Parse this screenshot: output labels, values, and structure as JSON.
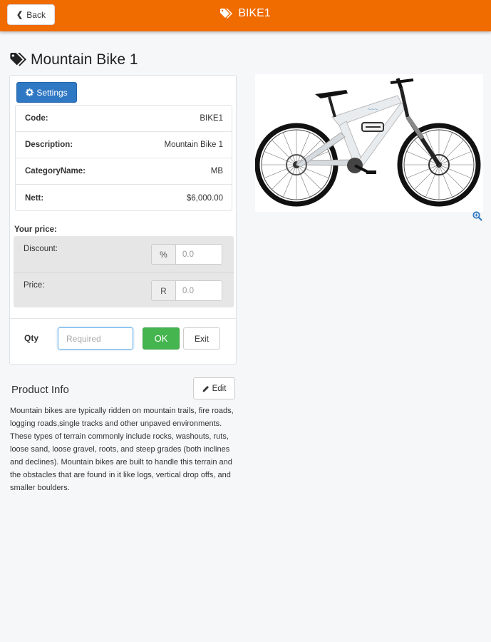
{
  "header": {
    "back_label": "Back",
    "title": "BIKE1",
    "bar_color": "#f06b00"
  },
  "product": {
    "title": "Mountain Bike 1",
    "settings_label": "Settings",
    "details": [
      {
        "label": "Code:",
        "value": "BIKE1"
      },
      {
        "label": "Description:",
        "value": "Mountain Bike 1"
      },
      {
        "label": "CategoryName:",
        "value": "MB"
      },
      {
        "label": "Nett:",
        "value": "$6,000.00"
      }
    ]
  },
  "pricing": {
    "heading": "Your price:",
    "discount": {
      "label": "Discount:",
      "addon": "%",
      "placeholder": "0.0"
    },
    "price": {
      "label": "Price:",
      "addon": "R",
      "placeholder": "0.0"
    }
  },
  "order": {
    "qty_label": "Qty",
    "qty_placeholder": "Required",
    "ok_label": "OK",
    "exit_label": "Exit"
  },
  "info": {
    "title": "Product Info",
    "edit_label": "Edit",
    "description": "Mountain bikes are typically ridden on mountain trails, fire roads, logging roads,single tracks and other unpaved environments. These types of terrain commonly include rocks, washouts, ruts, loose sand, loose gravel, roots, and steep grades (both inclines and declines). Mountain bikes are built to handle this terrain and the obstacles that are found in it like logs, vertical drop offs, and smaller boulders."
  },
  "icons": {
    "back": "chevron-left-icon",
    "tags": "tags-icon",
    "settings": "gear-icon",
    "edit": "pencil-icon",
    "zoom": "zoom-in-icon"
  },
  "colors": {
    "primary": "#2f78c4",
    "success": "#45b54f",
    "accent": "#f06b00"
  }
}
